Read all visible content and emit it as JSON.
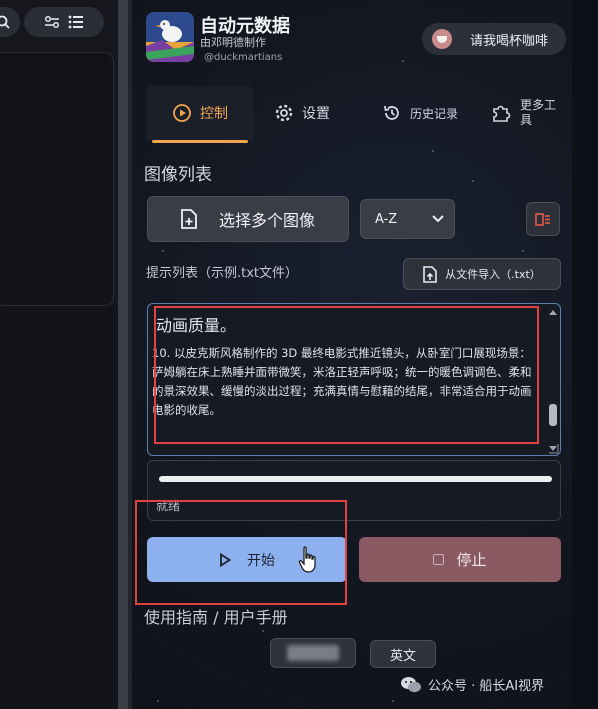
{
  "app": {
    "title": "自动元数据",
    "subtitle": "由邓明德制作",
    "handle": "@duckmartians",
    "coffee_label": "请我喝杯咖啡"
  },
  "tabs": [
    {
      "label": "控制",
      "icon": "play-circle-icon",
      "active": true
    },
    {
      "label": "设置",
      "icon": "gear-icon"
    },
    {
      "label": "历史记录",
      "icon": "history-icon"
    },
    {
      "label": "更多工具",
      "icon": "puzzle-icon"
    }
  ],
  "images": {
    "section_title": "图像列表",
    "choose_label": "选择多个图像",
    "sort_value": "A-Z"
  },
  "prompts": {
    "label": "提示列表（示例.txt文件）",
    "import_label": "从文件导入（.txt）",
    "heading": "动画质量。",
    "body": "10. 以皮克斯风格制作的 3D 最终电影式推近镜头，从卧室门口展现场景：萨姆躺在床上熟睡并面带微笑，米洛正轻声呼吸；统一的暖色调调色、柔和的景深效果、缓慢的淡出过程；充满真情与慰藉的结尾，非常适合用于动画电影的收尾。"
  },
  "progress": {
    "value": 1.0,
    "status": "就绪"
  },
  "actions": {
    "start_label": "开始",
    "stop_label": "停止"
  },
  "guide": {
    "title": "使用指南 / 用户手册",
    "english_label": "英文"
  },
  "watermark": {
    "text": "公众号 · 船长AI视界"
  },
  "colors": {
    "accent": "#f0a650",
    "start_button": "#8db1ee",
    "stop_button": "#8a5a62",
    "highlight": "#e0443f"
  }
}
